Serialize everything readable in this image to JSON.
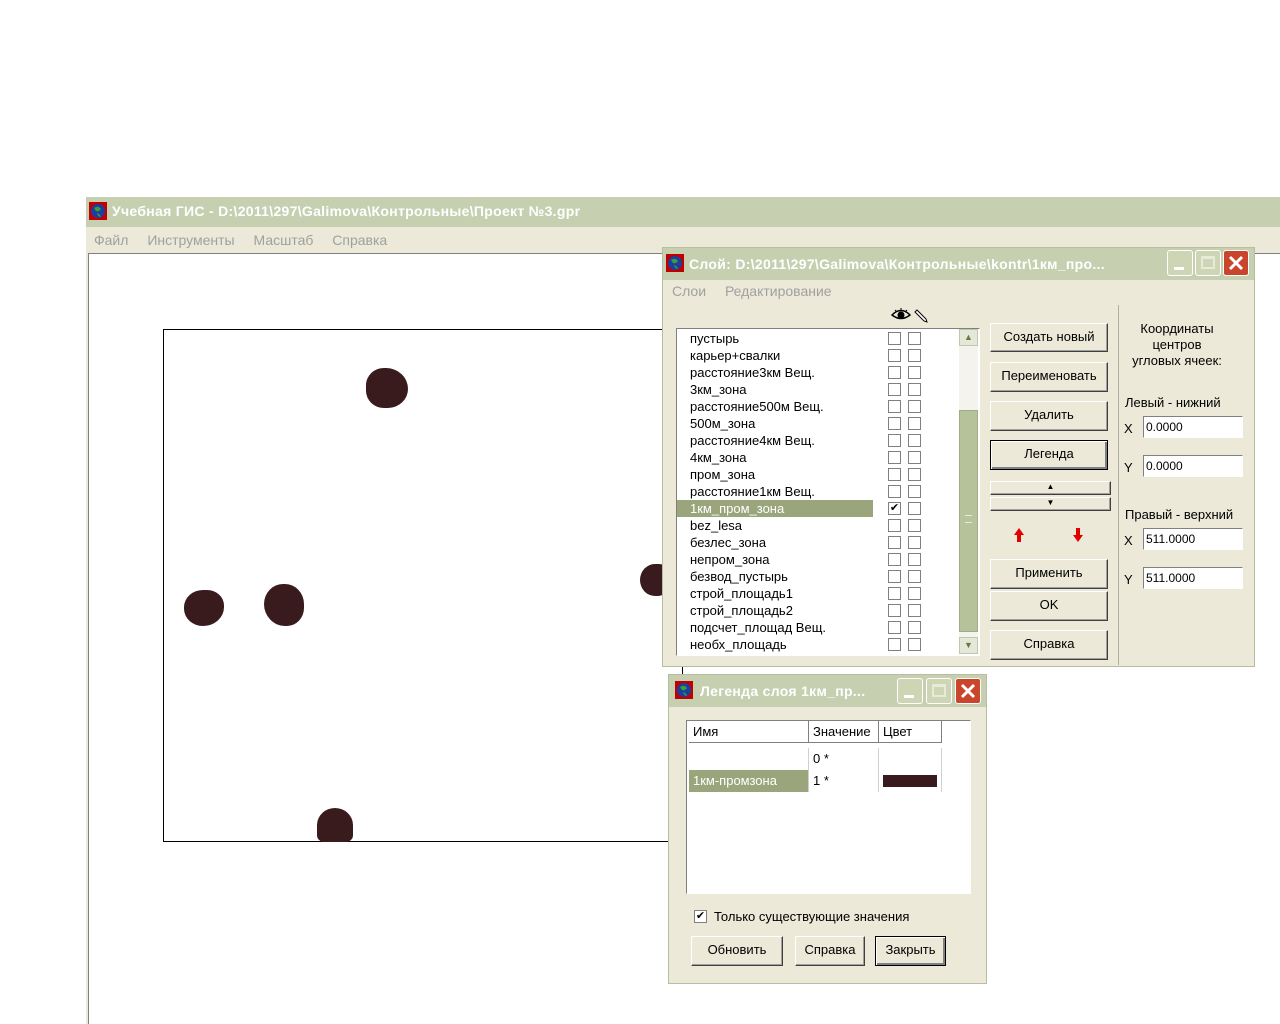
{
  "main_window": {
    "title": "Учебная ГИС - D:\\2011\\297\\Galimova\\Контрольные\\Проект №3.gpr",
    "menu": [
      "Файл",
      "Инструменты",
      "Масштаб",
      "Справка"
    ]
  },
  "layer_dialog": {
    "title": "Слой: D:\\2011\\297\\Galimova\\Контрольные\\kontr\\1км_про...",
    "menu": [
      "Слои",
      "Редактирование"
    ],
    "header_icons": [
      "eye-icon",
      "pencil-icon"
    ],
    "layers": [
      {
        "name": "пустырь",
        "visible": false,
        "edit": false
      },
      {
        "name": "карьер+свалки",
        "visible": false,
        "edit": false
      },
      {
        "name": "расстояние3км Вещ.",
        "visible": false,
        "edit": false
      },
      {
        "name": "3км_зона",
        "visible": false,
        "edit": false
      },
      {
        "name": "расстояние500м Вещ.",
        "visible": false,
        "edit": false
      },
      {
        "name": "500м_зона",
        "visible": false,
        "edit": false
      },
      {
        "name": "расстояние4км Вещ.",
        "visible": false,
        "edit": false
      },
      {
        "name": "4км_зона",
        "visible": false,
        "edit": false
      },
      {
        "name": "пром_зона",
        "visible": false,
        "edit": false
      },
      {
        "name": "расстояние1км Вещ.",
        "visible": false,
        "edit": false
      },
      {
        "name": "1км_пром_зона",
        "visible": true,
        "edit": false,
        "selected": true
      },
      {
        "name": "bez_lesa",
        "visible": false,
        "edit": false
      },
      {
        "name": "безлес_зона",
        "visible": false,
        "edit": false
      },
      {
        "name": "непром_зона",
        "visible": false,
        "edit": false
      },
      {
        "name": "безвод_пустырь",
        "visible": false,
        "edit": false
      },
      {
        "name": "строй_площадь1",
        "visible": false,
        "edit": false
      },
      {
        "name": "строй_площадь2",
        "visible": false,
        "edit": false
      },
      {
        "name": "подсчет_площад Вещ.",
        "visible": false,
        "edit": false
      },
      {
        "name": "необх_площадь",
        "visible": false,
        "edit": false
      }
    ],
    "buttons": {
      "create": "Создать новый",
      "rename": "Переименовать",
      "delete": "Удалить",
      "legend": "Легенда",
      "apply": "Применить",
      "ok": "OK",
      "help": "Справка"
    },
    "coords": {
      "heading": "Координаты центров угловых ячеек:",
      "heading_lines": [
        "Координаты",
        "центров",
        "угловых ячеек:"
      ],
      "lower_left": "Левый - нижний",
      "upper_right": "Правый - верхний",
      "x_label": "X",
      "y_label": "Y",
      "ll_x": "0.0000",
      "ll_y": "0.0000",
      "ur_x": "511.0000",
      "ur_y": "511.0000"
    }
  },
  "legend_dialog": {
    "title": "Легенда слоя 1км_пр...",
    "columns": [
      "Имя",
      "Значение",
      "Цвет"
    ],
    "rows": [
      {
        "name": "",
        "value": "0 *",
        "color": ""
      },
      {
        "name": "1км-промзона",
        "value": "1 *",
        "color": "#3a1b1d"
      }
    ],
    "checkbox_label": "Только существующие значения",
    "checkbox_checked": true,
    "buttons": {
      "refresh": "Обновить",
      "help": "Справка",
      "close": "Закрыть"
    }
  },
  "colors": {
    "zone_fill": "#3a1b1d",
    "selection": "#9aa57c",
    "titlebar": "#c6cfb0"
  }
}
